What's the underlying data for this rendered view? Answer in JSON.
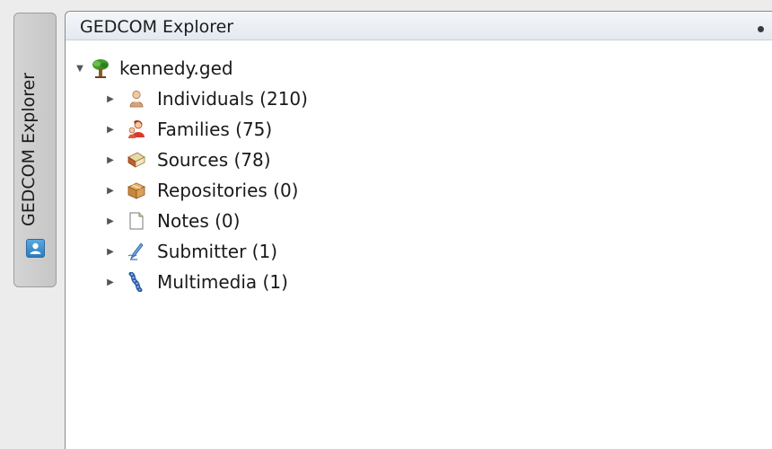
{
  "sidebar": {
    "tab_label": "GEDCOM Explorer",
    "tab_icon": "contact-card-icon"
  },
  "panel": {
    "title": "GEDCOM Explorer"
  },
  "tree": {
    "root": {
      "label": "kennedy.ged",
      "icon": "tree-icon",
      "expanded": true
    },
    "children": [
      {
        "label": "Individuals (210)",
        "icon": "person-icon"
      },
      {
        "label": "Families (75)",
        "icon": "family-icon"
      },
      {
        "label": "Sources (78)",
        "icon": "book-icon"
      },
      {
        "label": "Repositories (0)",
        "icon": "box-icon"
      },
      {
        "label": "Notes (0)",
        "icon": "note-icon"
      },
      {
        "label": "Submitter (1)",
        "icon": "submitter-icon"
      },
      {
        "label": "Multimedia (1)",
        "icon": "film-icon"
      }
    ]
  }
}
